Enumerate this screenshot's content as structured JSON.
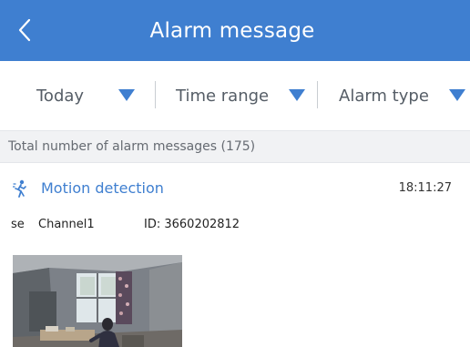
{
  "header": {
    "title": "Alarm message"
  },
  "filters": {
    "date_label": "Today",
    "time_range_label": "Time range",
    "alarm_type_label": "Alarm type"
  },
  "summary": {
    "total_text": "Total number of alarm messages (175)"
  },
  "alarm": {
    "type_label": "Motion detection",
    "time": "18:11:27",
    "device_prefix": "se",
    "channel": "Channel1",
    "id_text": "ID: 3660202812"
  },
  "colors": {
    "accent": "#3f7fd0",
    "header_bg": "#3f7fd0",
    "summary_bg": "#f1f2f4"
  },
  "icons": {
    "back": "chevron-left-icon",
    "dropdown": "triangle-down-icon",
    "motion": "motion-detection-icon"
  }
}
